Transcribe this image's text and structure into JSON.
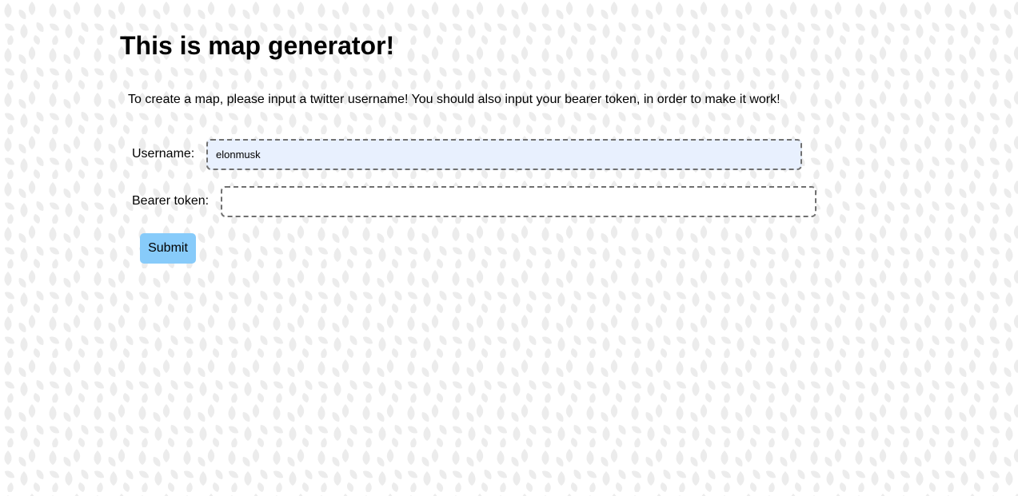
{
  "page": {
    "title": "This is map generator!",
    "intro": "To create a map, please input a twitter username! You should also input your bearer token, in order to make it work!"
  },
  "form": {
    "username_label": "Username:",
    "username_value": "elonmusk",
    "token_label": "Bearer token:",
    "token_value": "",
    "submit_label": "Submit"
  },
  "colors": {
    "background": "#ffffff",
    "pattern_leaf": "#ececec",
    "autofill_input_bg": "#e8f0fe",
    "input_border": "#707070",
    "submit_bg": "#87cbfa"
  },
  "background_pattern": "leaf-pattern"
}
